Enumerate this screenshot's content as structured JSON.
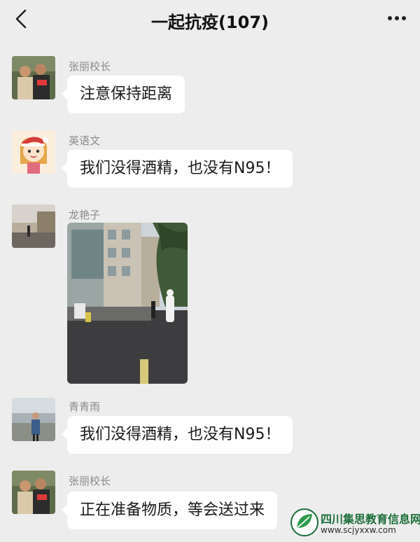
{
  "header": {
    "title": "一起抗疫(107)",
    "back_icon": "chevron-left-icon",
    "more_icon": "more-dots-icon"
  },
  "messages": [
    {
      "sender": "张丽校长",
      "text": "注意保持距离",
      "avatar": "avatar-photo-couple"
    },
    {
      "sender": "英语文",
      "text": "我们没得酒精，也没有N95！",
      "avatar": "avatar-cartoon-girl-santa-hat"
    },
    {
      "sender": "龙艳子",
      "image": "street-with-person-in-protective-suit",
      "avatar": "avatar-street-photo"
    },
    {
      "sender": "青青雨",
      "text": "我们没得酒精，也没有N95！",
      "avatar": "avatar-person-outdoor"
    },
    {
      "sender": "张丽校长",
      "text": "正在准备物质，等会送过来",
      "avatar": "avatar-photo-couple"
    }
  ],
  "watermark": {
    "name": "四川集思教育信息网",
    "url": "www.scjyxxw.com",
    "color": "#1c6e3a"
  }
}
